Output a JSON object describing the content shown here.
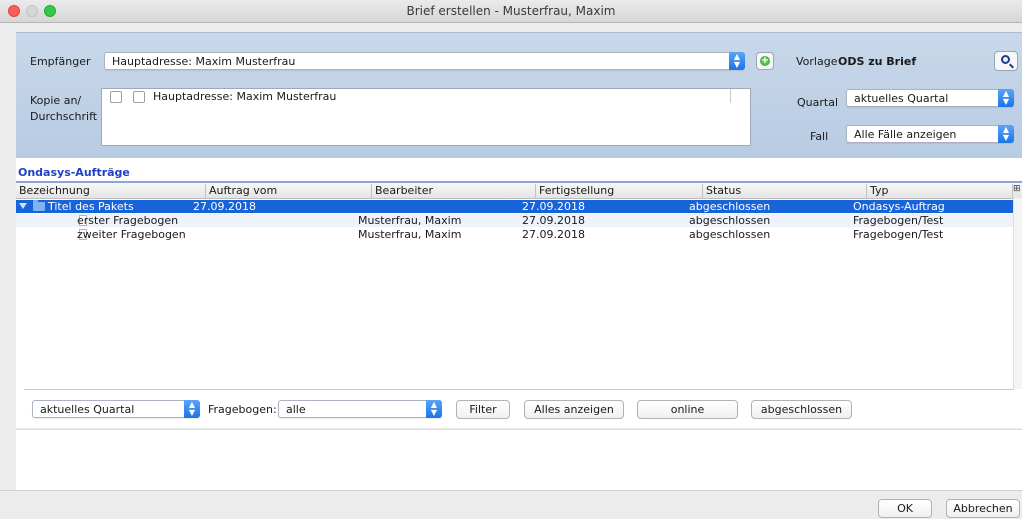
{
  "window": {
    "title": "Brief erstellen - Musterfrau, Maxim"
  },
  "header": {
    "empfaenger_label": "Empfänger",
    "empfaenger_value": "Hauptadresse: Maxim Musterfrau",
    "vorlage_label": "Vorlage",
    "vorlage_value": "ODS zu Brief",
    "kopie_label_line1": "Kopie an/",
    "kopie_label_line2": "Durchschrift",
    "kopie_item": "Hauptadresse: Maxim Musterfrau",
    "quartal_label": "Quartal",
    "quartal_value": "aktuelles Quartal",
    "fall_label": "Fall",
    "fall_value": "Alle Fälle anzeigen"
  },
  "section": {
    "title": "Ondasys-Aufträge"
  },
  "table": {
    "columns": [
      "Bezeichnung",
      "Auftrag vom",
      "Bearbeiter",
      "Fertigstellung",
      "Status",
      "Typ"
    ],
    "rows": [
      {
        "bezeichnung": "Titel des Pakets",
        "auftrag_vom": "27.09.2018",
        "bearbeiter": "",
        "fertigstellung": "27.09.2018",
        "status": "abgeschlossen",
        "typ": "Ondasys-Auftrag"
      },
      {
        "bezeichnung": "erster Fragebogen",
        "auftrag_vom": "",
        "bearbeiter": "Musterfrau, Maxim",
        "fertigstellung": "27.09.2018",
        "status": "abgeschlossen",
        "typ": "Fragebogen/Test"
      },
      {
        "bezeichnung": "zweiter Fragebogen",
        "auftrag_vom": "",
        "bearbeiter": "Musterfrau, Maxim",
        "fertigstellung": "27.09.2018",
        "status": "abgeschlossen",
        "typ": "Fragebogen/Test"
      }
    ]
  },
  "filterbar": {
    "quartal_value": "aktuelles Quartal",
    "fragebogen_label": "Fragebogen:",
    "fragebogen_value": "alle",
    "filter_button": "Filter",
    "alles_button": "Alles anzeigen",
    "online_button": "online",
    "abgeschlossen_button": "abgeschlossen"
  },
  "footer": {
    "ok_button": "OK",
    "cancel_button": "Abbrechen"
  },
  "icons": {
    "add": "add-circle-icon",
    "search": "magnifier-icon",
    "combo": "chevron-updown-icon",
    "folder": "folder-icon",
    "document": "document-icon"
  }
}
